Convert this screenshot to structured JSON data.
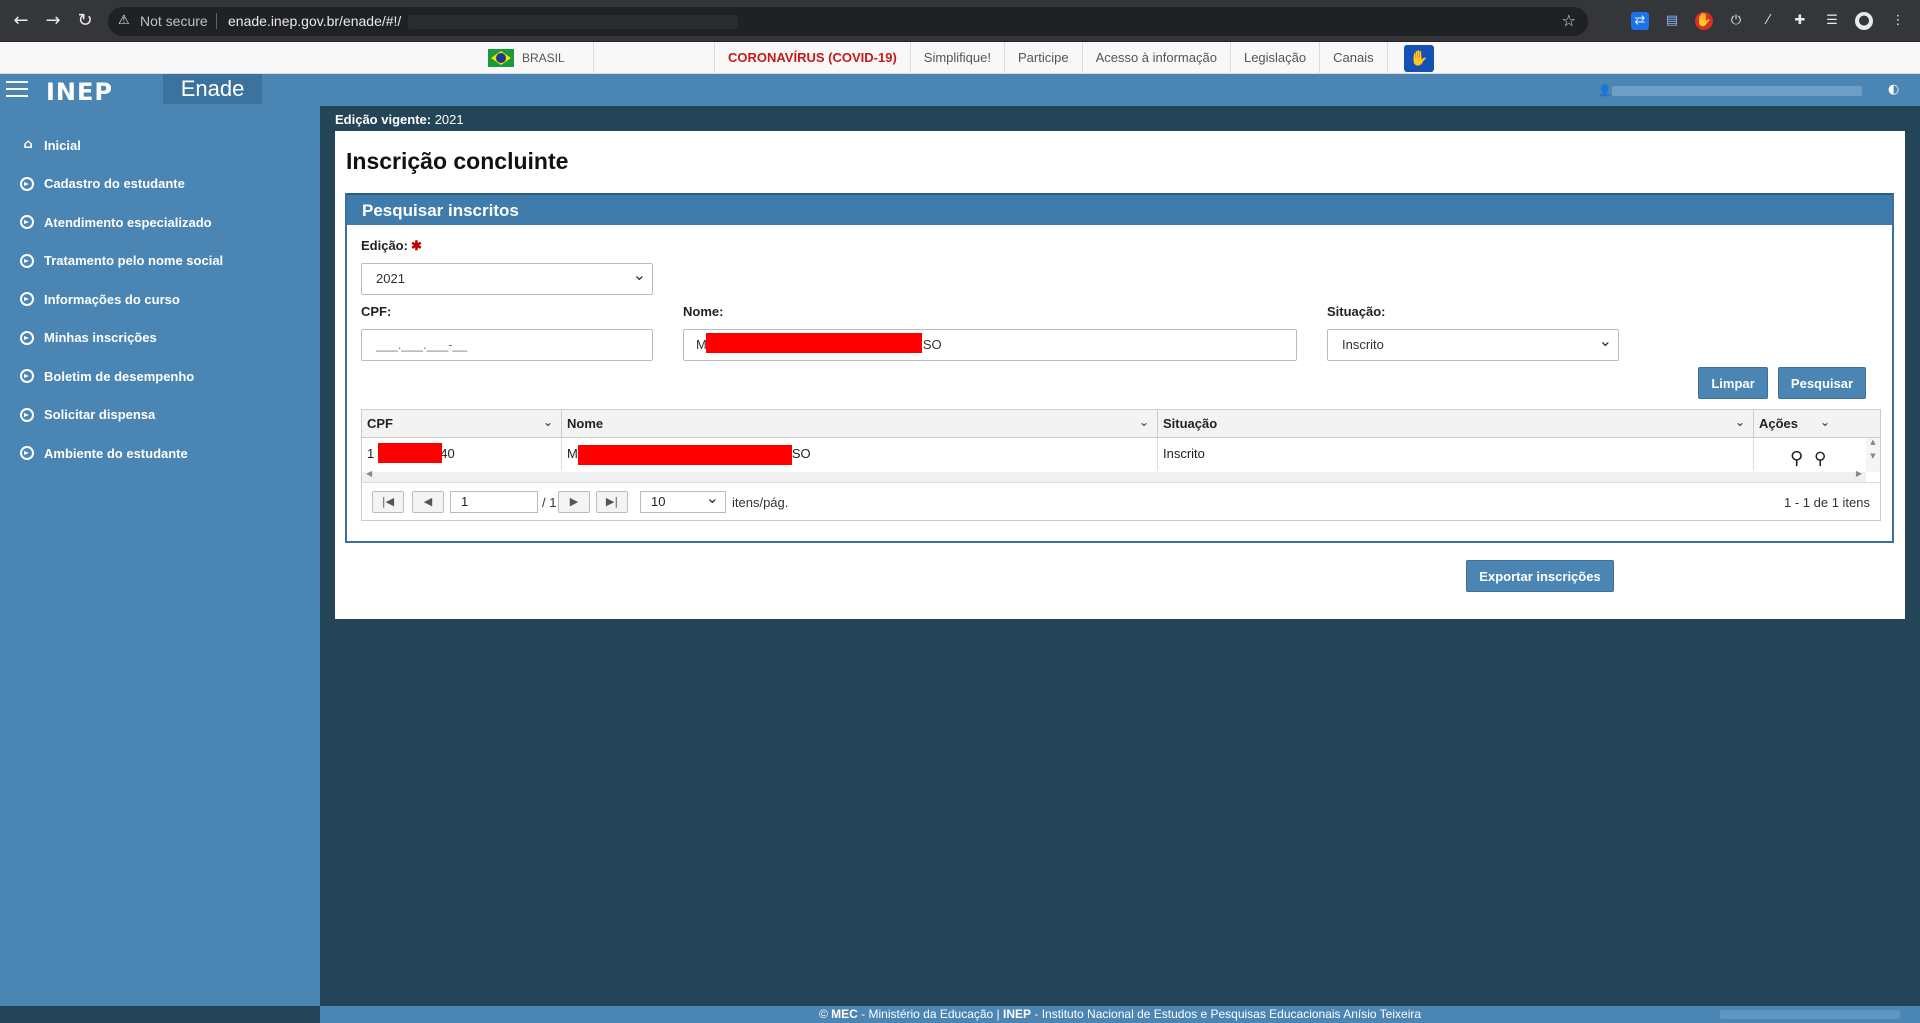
{
  "browser": {
    "security_label": "Not secure",
    "url": "enade.inep.gov.br/enade/#!/"
  },
  "govbar": {
    "country": "BRASIL",
    "links": [
      "CORONAVÍRUS (COVID-19)",
      "Simplifique!",
      "Participe",
      "Acesso à informação",
      "Legislação",
      "Canais"
    ]
  },
  "header": {
    "logo": "INEP",
    "app_name": "Enade"
  },
  "sidebar": {
    "items": [
      {
        "label": "Inicial",
        "icon": "home-icon"
      },
      {
        "label": "Cadastro do estudante",
        "icon": "arrow-circle-icon"
      },
      {
        "label": "Atendimento especializado",
        "icon": "arrow-circle-icon"
      },
      {
        "label": "Tratamento pelo nome social",
        "icon": "arrow-circle-icon"
      },
      {
        "label": "Informações do curso",
        "icon": "arrow-circle-icon"
      },
      {
        "label": "Minhas inscrições",
        "icon": "arrow-circle-icon"
      },
      {
        "label": "Boletim de desempenho",
        "icon": "arrow-circle-icon"
      },
      {
        "label": "Solicitar dispensa",
        "icon": "arrow-circle-icon"
      },
      {
        "label": "Ambiente do estudante",
        "icon": "arrow-circle-icon"
      }
    ]
  },
  "main": {
    "edicao_vigente_label": "Edição vigente:",
    "edicao_vigente_value": "2021",
    "title": "Inscrição concluinte",
    "search": {
      "heading": "Pesquisar inscritos",
      "edicao_label": "Edição:",
      "edicao_value": "2021",
      "cpf_label": "CPF:",
      "cpf_placeholder": "___.___.___-__",
      "nome_label": "Nome:",
      "nome_prefix": "M",
      "nome_suffix": "SO",
      "situacao_label": "Situação:",
      "situacao_value": "Inscrito",
      "limpar_label": "Limpar",
      "pesquisar_label": "Pesquisar"
    },
    "grid": {
      "columns": [
        "CPF",
        "Nome",
        "Situação",
        "Ações"
      ],
      "row": {
        "cpf_prefix": "1",
        "cpf_suffix": "40",
        "nome_prefix": "M",
        "nome_suffix": "SO",
        "situacao": "Inscrito"
      },
      "pager": {
        "page": "1",
        "of": "/ 1",
        "per_page": "10",
        "per_page_label": "itens/pág.",
        "summary": "1 - 1 de 1 itens"
      }
    },
    "export_label": "Exportar inscrições"
  },
  "footer": {
    "mec": "MEC",
    "mec_text": " - Ministério da Educação | ",
    "inep": "INEP",
    "inep_text": " - Instituto Nacional de Estudos e Pesquisas Educacionais Anísio Teixeira"
  }
}
